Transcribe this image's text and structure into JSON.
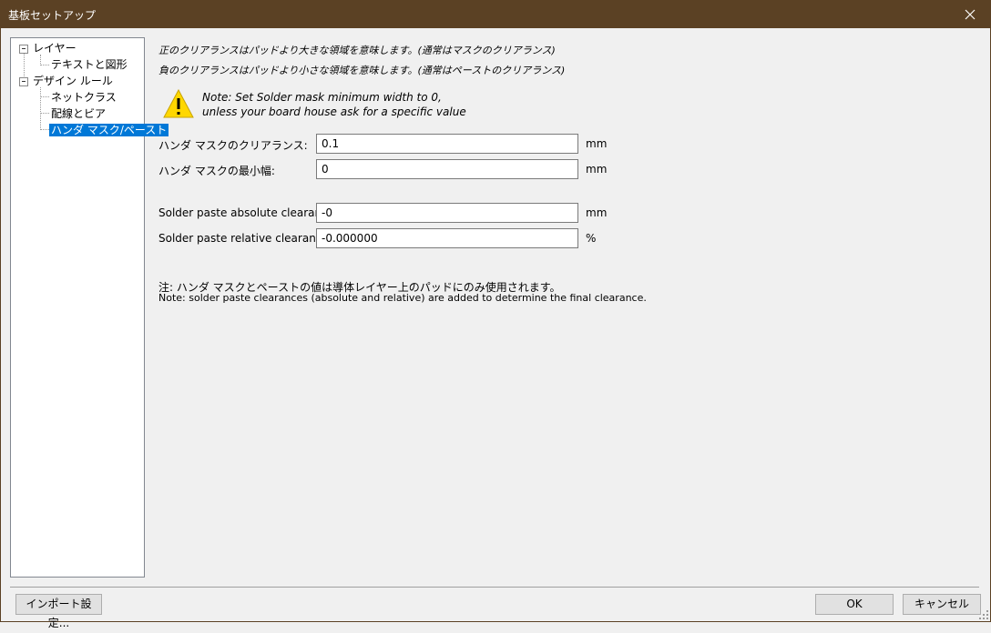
{
  "window": {
    "title": "基板セットアップ"
  },
  "tree": {
    "items": [
      {
        "label": "レイヤー"
      },
      {
        "label": "テキストと図形"
      },
      {
        "label": "デザイン ルール"
      },
      {
        "label": "ネットクラス"
      },
      {
        "label": "配線とビア"
      },
      {
        "label": "ハンダ マスク/ペースト"
      }
    ]
  },
  "main": {
    "hint1": "正のクリアランスはパッドより大きな領域を意味します。(通常はマスクのクリアランス)",
    "hint2": "負のクリアランスはパッドより小さな領域を意味します。(通常はペーストのクリアランス)",
    "note_line1": "Note: Set Solder mask minimum width to 0,",
    "note_line2": "unless your board house ask for a specific value",
    "fields": [
      {
        "label": "ハンダ マスクのクリアランス:",
        "value": "0.1",
        "unit": "mm"
      },
      {
        "label": "ハンダ マスクの最小幅:",
        "value": "0",
        "unit": "mm"
      },
      {
        "label": "Solder paste absolute clearance:",
        "value": "-0",
        "unit": "mm"
      },
      {
        "label": "Solder paste relative clearance:",
        "value": "-0.000000",
        "unit": "%"
      }
    ],
    "footnote1": "注: ハンダ マスクとペーストの値は導体レイヤー上のパッドにのみ使用されます。",
    "footnote2": "Note: solder paste clearances (absolute and relative) are added to determine the final clearance."
  },
  "footer": {
    "import_label": "インポート設定...",
    "ok_label": "OK",
    "cancel_label": "キャンセル"
  },
  "colors": {
    "titlebar": "#5b4124",
    "selection": "#0078d7",
    "warning": "#ffd700"
  }
}
